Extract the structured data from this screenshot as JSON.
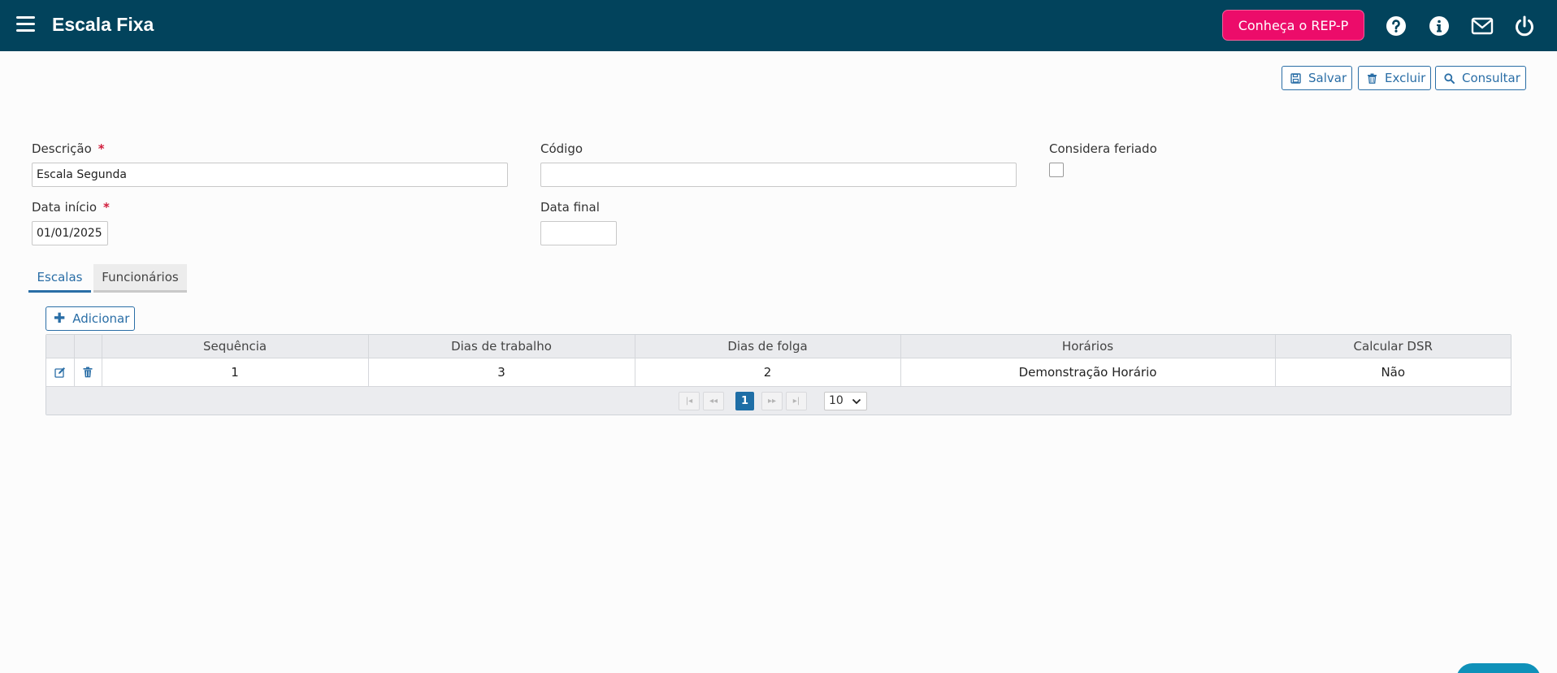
{
  "header": {
    "title": "Escala Fixa",
    "promo_label": "Conheça o REP-P",
    "icons": [
      "menu-icon",
      "help-icon",
      "info-icon",
      "mail-icon",
      "power-icon"
    ]
  },
  "toolbar": {
    "save_label": "Salvar",
    "delete_label": "Excluir",
    "search_label": "Consultar"
  },
  "form": {
    "descricao_label": "Descrição",
    "descricao_value": "Escala Segunda",
    "codigo_label": "Código",
    "codigo_value": "",
    "feriado_label": "Considera feriado",
    "feriado_checked": false,
    "data_inicio_label": "Data início",
    "data_inicio_value": "01/01/2025",
    "data_final_label": "Data final",
    "data_final_value": "",
    "required_mark": "*"
  },
  "tabs": [
    {
      "label": "Escalas",
      "active": true
    },
    {
      "label": "Funcionários",
      "active": false
    }
  ],
  "grid": {
    "add_label": "Adicionar",
    "columns": [
      "Sequência",
      "Dias de trabalho",
      "Dias de folga",
      "Horários",
      "Calcular DSR"
    ],
    "rows": [
      {
        "sequencia": "1",
        "dias_trabalho": "3",
        "dias_folga": "2",
        "horarios": "Demonstração Horário",
        "calcular_dsr": "Não"
      }
    ],
    "pager": {
      "first": "|◂",
      "prev": "◂◂",
      "current_page": "1",
      "next": "▸▸",
      "last": "▸|",
      "page_size": "10"
    }
  },
  "colors": {
    "header_bg": "#02435c",
    "promo_bg": "#ec0c6a",
    "accent": "#2a6ea6",
    "required": "#d11d3c"
  }
}
